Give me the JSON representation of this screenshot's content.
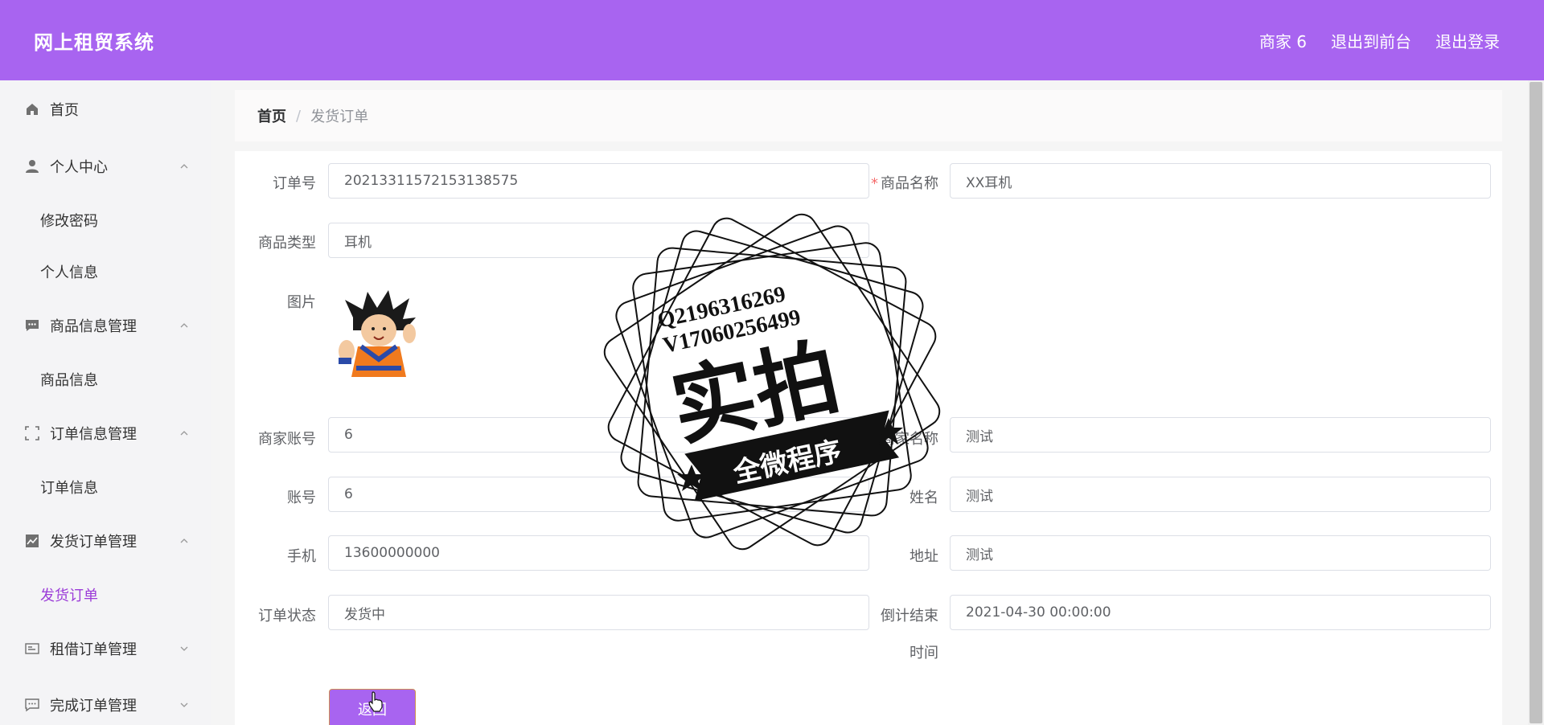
{
  "header": {
    "brand": "网上租贸系统",
    "nav": [
      "商家 6",
      "退出到前台",
      "退出登录"
    ]
  },
  "sidebar": {
    "items": [
      {
        "label": "首页",
        "icon": "home-icon"
      },
      {
        "label": "个人中心",
        "icon": "user-icon",
        "children": [
          "修改密码",
          "个人信息"
        ]
      },
      {
        "label": "商品信息管理",
        "icon": "chat-icon",
        "children": [
          "商品信息"
        ]
      },
      {
        "label": "订单信息管理",
        "icon": "frame-icon",
        "children": [
          "订单信息"
        ]
      },
      {
        "label": "发货订单管理",
        "icon": "chart-icon",
        "children": [
          "发货订单"
        ]
      },
      {
        "label": "租借订单管理",
        "icon": "card-icon"
      },
      {
        "label": "完成订单管理",
        "icon": "message-icon"
      }
    ],
    "active": "发货订单"
  },
  "breadcrumb": {
    "home": "首页",
    "sep": "/",
    "current": "发货订单"
  },
  "form": {
    "order_no_label": "订单号",
    "order_no": "20213311572153138575",
    "goods_name_label": "商品名称",
    "goods_name": "XX耳机",
    "goods_type_label": "商品类型",
    "goods_type": "耳机",
    "image_label": "图片",
    "merchant_account_label": "商家账号",
    "merchant_account": "6",
    "merchant_name_label": "商家名称",
    "merchant_name": "测试",
    "account_label": "账号",
    "account": "6",
    "name_label": "姓名",
    "name": "测试",
    "phone_label": "手机",
    "phone": "13600000000",
    "address_label": "地址",
    "address": "测试",
    "status_label": "订单状态",
    "status": "发货中",
    "countdown_label_line1": "倒计结束",
    "countdown_label_line2": "时间",
    "countdown": "2021-04-30 00:00:00",
    "back_button": "返回"
  },
  "watermark": {
    "qq": "Q2196316269",
    "vx": "V17060256499",
    "big": "实拍",
    "banner": "全微程序"
  },
  "colors": {
    "accent": "#a864f0",
    "active_text": "#9b3bd8"
  }
}
